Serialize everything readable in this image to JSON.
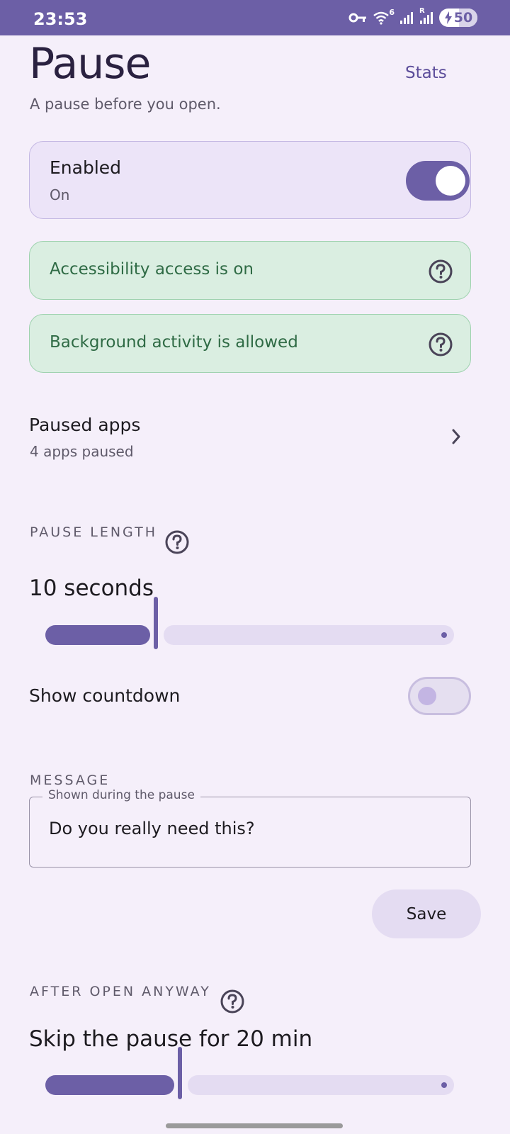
{
  "status_bar": {
    "time": "23:53",
    "network_label": "6",
    "roaming_label": "R",
    "battery_level": "50",
    "icons": [
      "vpn-key-icon",
      "wifi-icon",
      "signal-icon",
      "signal-roaming-icon",
      "battery-charging-icon"
    ]
  },
  "header": {
    "title": "Pause",
    "stats_label": "Stats",
    "subtitle": "A pause before you open."
  },
  "enabled_card": {
    "label": "Enabled",
    "state": "On",
    "toggle_on": true
  },
  "status_cards": [
    {
      "text": "Accessibility access is on",
      "icon": "help-icon"
    },
    {
      "text": "Background activity is allowed",
      "icon": "help-icon"
    }
  ],
  "paused_apps": {
    "label": "Paused apps",
    "count_text": "4 apps paused"
  },
  "pause_length": {
    "header": "PAUSE LENGTH",
    "value_text": "10 seconds",
    "slider_fraction": 0.27
  },
  "show_countdown": {
    "label": "Show countdown",
    "toggle_on": false
  },
  "message": {
    "header": "MESSAGE",
    "field_label": "Shown during the pause",
    "value": "Do you really need this?",
    "save_label": "Save"
  },
  "after_open": {
    "header": "AFTER OPEN ANYWAY",
    "value_text": "Skip the pause for 20 min",
    "slider_fraction": 0.33
  },
  "colors": {
    "accent": "#6c5fa6",
    "background": "#f5effa",
    "success_bg": "#daeee1",
    "success_text": "#2f6b45"
  }
}
